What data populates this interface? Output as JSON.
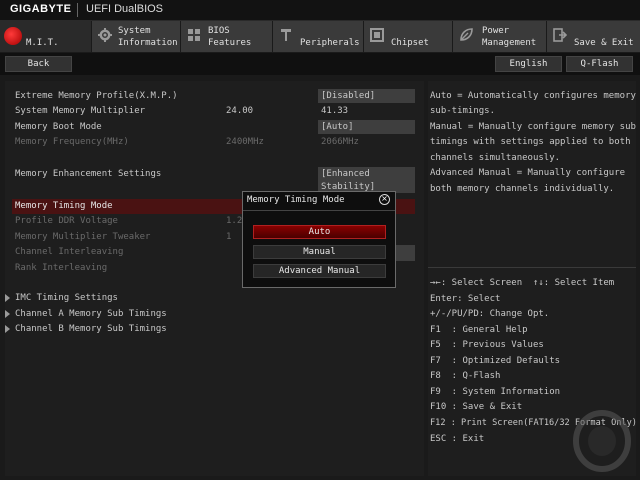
{
  "brand": "GIGABYTE",
  "product": "UEFI DualBIOS",
  "tabs": [
    {
      "id": "mit",
      "line1": "M.I.T.",
      "line2": ""
    },
    {
      "id": "system",
      "line1": "System",
      "line2": "Information"
    },
    {
      "id": "bios",
      "line1": "BIOS",
      "line2": "Features"
    },
    {
      "id": "peripherals",
      "line1": "Peripherals",
      "line2": ""
    },
    {
      "id": "chipset",
      "line1": "Chipset",
      "line2": ""
    },
    {
      "id": "power",
      "line1": "Power",
      "line2": "Management"
    },
    {
      "id": "save",
      "line1": "Save & Exit",
      "line2": ""
    }
  ],
  "toolbar": {
    "back": "Back",
    "language": "English",
    "qflash": "Q-Flash"
  },
  "settings": [
    {
      "label": "Extreme Memory Profile(X.M.P.)",
      "mid": "",
      "value": "[Disabled]",
      "dim": false,
      "boxed": true
    },
    {
      "label": "System Memory Multiplier",
      "mid": "24.00",
      "value": "41.33",
      "dim": false,
      "boxed": false
    },
    {
      "label": "Memory Boot Mode",
      "mid": "",
      "value": "[Auto]",
      "dim": false,
      "boxed": true
    },
    {
      "label": "Memory Frequency(MHz)",
      "mid": "2400MHz",
      "value": "2066MHz",
      "dim": true,
      "boxed": false
    },
    {
      "label": "Memory Enhancement Settings",
      "mid": "",
      "value": "[Enhanced",
      "value2": "Stability]",
      "dim": false,
      "boxed": true
    },
    {
      "label": "Memory Timing Mode",
      "mid": "",
      "value": "",
      "dim": false,
      "boxed": false
    },
    {
      "label": "Profile DDR Voltage",
      "mid": "1.2",
      "value": "",
      "dim": true,
      "boxed": false
    },
    {
      "label": "Memory Multiplier Tweaker",
      "mid": "1",
      "value": "",
      "dim": true,
      "boxed": false
    },
    {
      "label": "Channel Interleaving",
      "mid": "",
      "value": "",
      "dim": true,
      "boxed": false
    },
    {
      "label": "Rank Interleaving",
      "mid": "",
      "value": "",
      "dim": true,
      "boxed": false
    }
  ],
  "submenus": [
    "IMC Timing Settings",
    "Channel A Memory Sub Timings",
    "Channel B Memory Sub Timings"
  ],
  "description": [
    "Auto = Automatically configures memory",
    "sub-timings.",
    "Manual = Manually configure memory sub",
    "timings with settings applied to both",
    "channels simultaneously.",
    "Advanced Manual = Manually configure",
    "both memory channels individually."
  ],
  "keys": [
    "→←: Select Screen  ↑↓: Select Item",
    "Enter: Select",
    "+/-/PU/PD: Change Opt.",
    "F1  : General Help",
    "F5  : Previous Values",
    "F7  : Optimized Defaults",
    "F8  : Q-Flash",
    "F9  : System Information",
    "F10 : Save & Exit",
    "F12 : Print Screen(FAT16/32 Format Only)",
    "ESC : Exit"
  ],
  "popup": {
    "title": "Memory Timing Mode",
    "close_icon": "close-icon",
    "options": [
      "Auto",
      "Manual",
      "Advanced Manual"
    ],
    "selected": "Auto"
  },
  "colors": {
    "accent": "#b00000",
    "highlight": "#4a1212",
    "panel": "#1e1e1e"
  }
}
